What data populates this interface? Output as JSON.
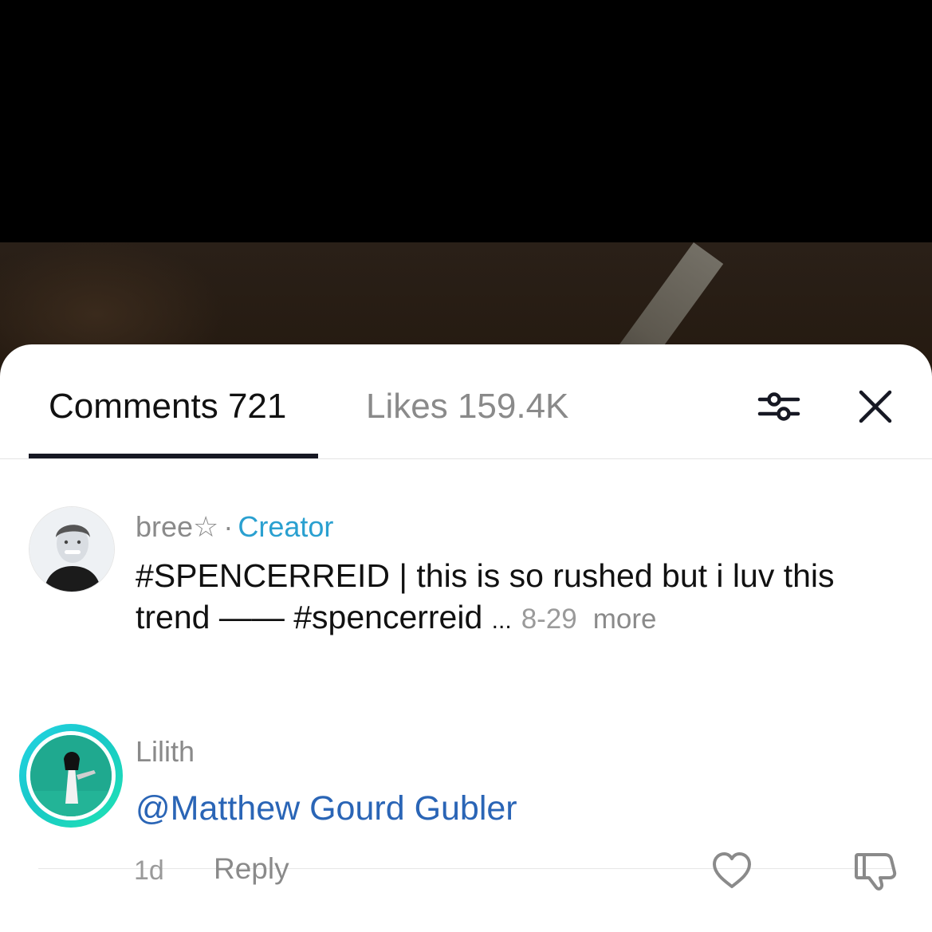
{
  "tabs": {
    "comments_label": "Comments 721",
    "likes_label": "Likes 159.4K"
  },
  "icons": {
    "filter": "filter-sliders-icon",
    "close": "close-icon",
    "heart": "heart-icon",
    "dislike": "thumbs-down-icon"
  },
  "creator_comment": {
    "username": "bree☆",
    "separator": "·",
    "badge": "Creator",
    "text": "#SPENCERREID | this is so rushed but i luv this trend —— #spencerreid",
    "ellipsis": "...",
    "date": "8-29",
    "more": "more"
  },
  "comment": {
    "username": "Lilith",
    "mention": "@Matthew Gourd Gubler",
    "time": "1d",
    "reply_label": "Reply"
  },
  "colors": {
    "creator_badge": "#2aa0d0",
    "mention": "#2a65b6",
    "avatar_ring_start": "#25d5e4",
    "avatar_ring_end": "#20e3b2"
  }
}
